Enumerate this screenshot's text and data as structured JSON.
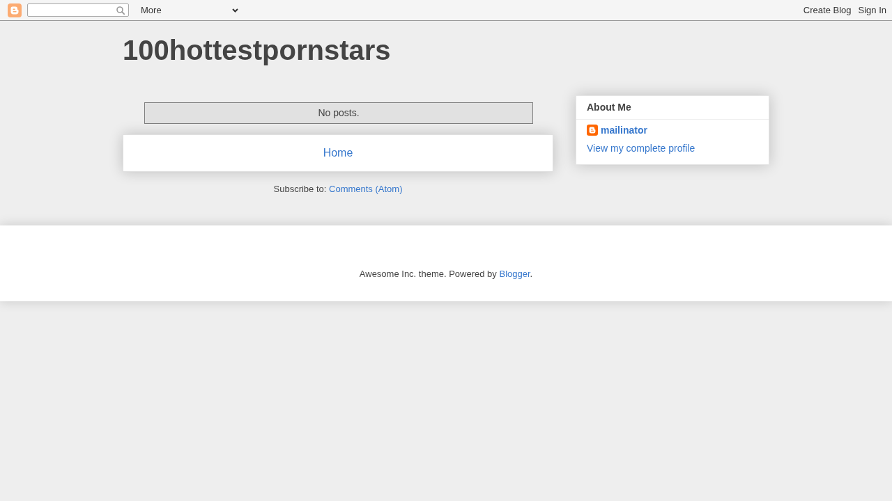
{
  "navbar": {
    "more_menu": "More",
    "links": [
      "Create Blog",
      "Sign In"
    ]
  },
  "blog_title": "100hottestpornstars",
  "posts": {
    "message": "No posts."
  },
  "home_link": "Home",
  "subscribe": {
    "label": "Subscribe to:",
    "link": "Comments (Atom)"
  },
  "about_me": {
    "title": "About Me",
    "name": "mailinator",
    "profile_link": "View my complete profile"
  },
  "footer": {
    "text": "Awesome Inc. theme. Powered by",
    "link": "Blogger",
    "suffix": "."
  }
}
